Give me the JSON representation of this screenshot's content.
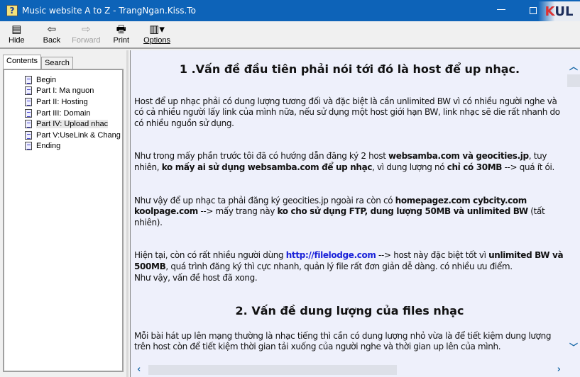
{
  "window": {
    "title": "Music website A to Z - TrangNgan.Kiss.To",
    "logo_text": "KUL",
    "logo_sub": "KUL.VN"
  },
  "toolbar": {
    "hide": "Hide",
    "back": "Back",
    "forward": "Forward",
    "print": "Print",
    "options": "Options"
  },
  "nav": {
    "tabs": [
      "Contents",
      "Search"
    ],
    "active_tab": "Contents",
    "items": [
      "Begin",
      "Part I: Ma nguon",
      "Part II: Hosting",
      "Part III: Domain",
      "Part IV: Upload nhac",
      "Part V:UseLink & Chang",
      "Ending"
    ],
    "selected": "Part IV: Upload nhac"
  },
  "content": {
    "h1": "1 .Vấn đề đầu tiên phải nói tới đó là host để up nhạc.",
    "p1": "Host để up nhạc phải có dung lượng tương đối và đặc biệt là cần unlimited BW vì có nhiều người nghe và có cả nhiều người lấy link của mình nữa, nếu sử dụng một host giới hạn BW, link nhạc sẽ die rất nhanh do có nhiều nguồn sử dụng.",
    "p2": [
      "Như trong mấy phần trước tôi đã có hướng dẫn đăng ký 2 host ",
      "websamba.com và geocities.jp",
      ", tuy nhiên, ",
      "ko mấy ai sử dụng websamba.com để up nhạc",
      ", vì dung lượng nó ",
      "chỉ có 30MB",
      " --> quá ít ói."
    ],
    "p3": [
      "Như vậy để up nhạc ta phải đăng ký geocities.jp ngoài ra còn có ",
      "homepagez.com cybcity.com koolpage.com",
      " --> mấy trang này ",
      "ko cho sử dụng FTP, dung lượng 50MB và unlimited BW",
      " (tất nhiên)."
    ],
    "p4": [
      "Hiện tại, còn có rất nhiều người dùng ",
      "http://filelodge.com",
      " --> host này đặc biệt tốt vì ",
      "unlimited BW và 500MB",
      ", quá trình đăng ký thì cực nhanh, quản lý file rất đơn giản dễ dàng. có nhiều ưu điểm.",
      "Như vậy, vấn đề host đã xong."
    ],
    "h2": "2. Vấn đề dung lượng của files nhạc",
    "p5": "Mỗi bài hát up lên mạng thường là nhạc tiếng thì cần có dung lượng nhỏ vừa là để tiết kiệm dung lượng trên host còn để tiết kiệm thời gian tải xuống của người nghe và thời gian up lên của mình."
  },
  "colors": {
    "titlebar": "#0d63b8",
    "content_bg": "#eef0fb",
    "link": "#1a22d8"
  }
}
